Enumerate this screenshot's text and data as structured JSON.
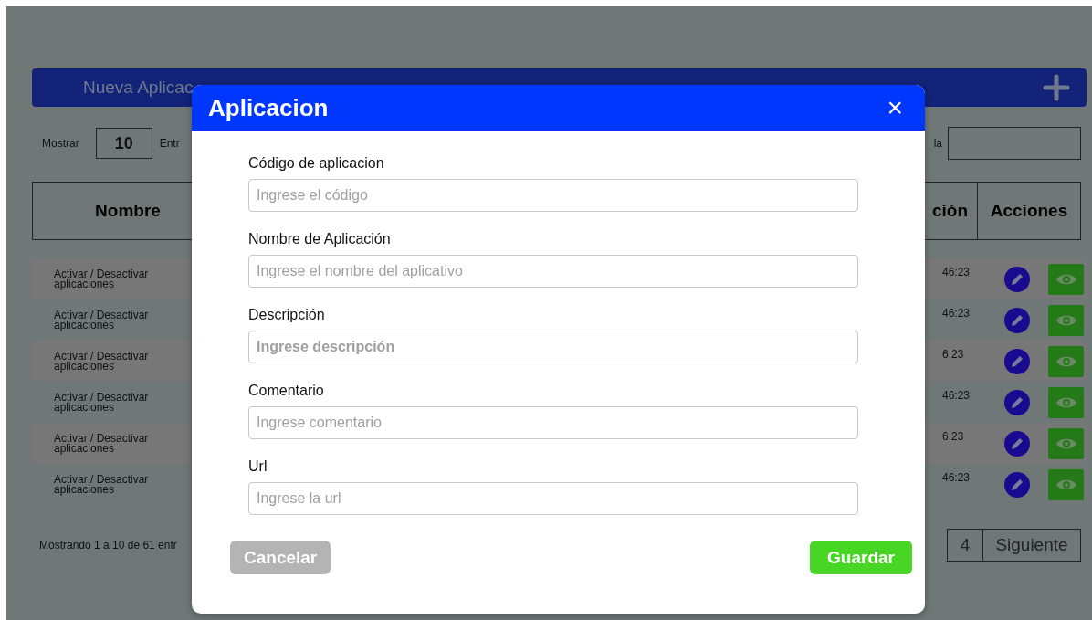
{
  "page": {
    "new_button": "Nueva Aplicac",
    "show_label": "Mostrar",
    "page_size": "10",
    "entries_label": "Entr",
    "search_label": "la"
  },
  "table": {
    "columns": [
      "Nombre",
      "ción",
      "Acciones"
    ],
    "rows": [
      {
        "name": "Activar / Desactivar aplicaciones",
        "time": "46:23"
      },
      {
        "name": "Activar / Desactivar aplicaciones",
        "time": "46:23"
      },
      {
        "name": "Activar / Desactivar aplicaciones",
        "time": "6:23"
      },
      {
        "name": "Activar / Desactivar aplicaciones",
        "time": "46:23"
      },
      {
        "name": "Activar / Desactivar aplicaciones",
        "time": "6:23"
      },
      {
        "name": "Activar / Desactivar aplicaciones",
        "time": "46:23"
      }
    ]
  },
  "footer": {
    "summary": "Mostrando 1 a 10 de 61 entr",
    "pages": [
      "4"
    ],
    "next": "Siguiente"
  },
  "dialog": {
    "title": "Aplicacion",
    "close": "×",
    "fields": [
      {
        "label": "Código de aplicacion",
        "placeholder": "Ingrese el código",
        "bold": false
      },
      {
        "label": "Nombre de Aplicación",
        "placeholder": "Ingrese el nombre del aplicativo",
        "bold": false
      },
      {
        "label": "Descripción",
        "placeholder": "Ingrese descripción",
        "bold": true
      },
      {
        "label": "Comentario",
        "placeholder": "Ingrese comentario",
        "bold": false
      },
      {
        "label": "Url",
        "placeholder": "Ingrese la url",
        "bold": false
      }
    ],
    "buttons": [
      {
        "label": "Cancelar",
        "kind": "cancel"
      },
      {
        "label": "Guardar",
        "kind": "save"
      }
    ]
  }
}
